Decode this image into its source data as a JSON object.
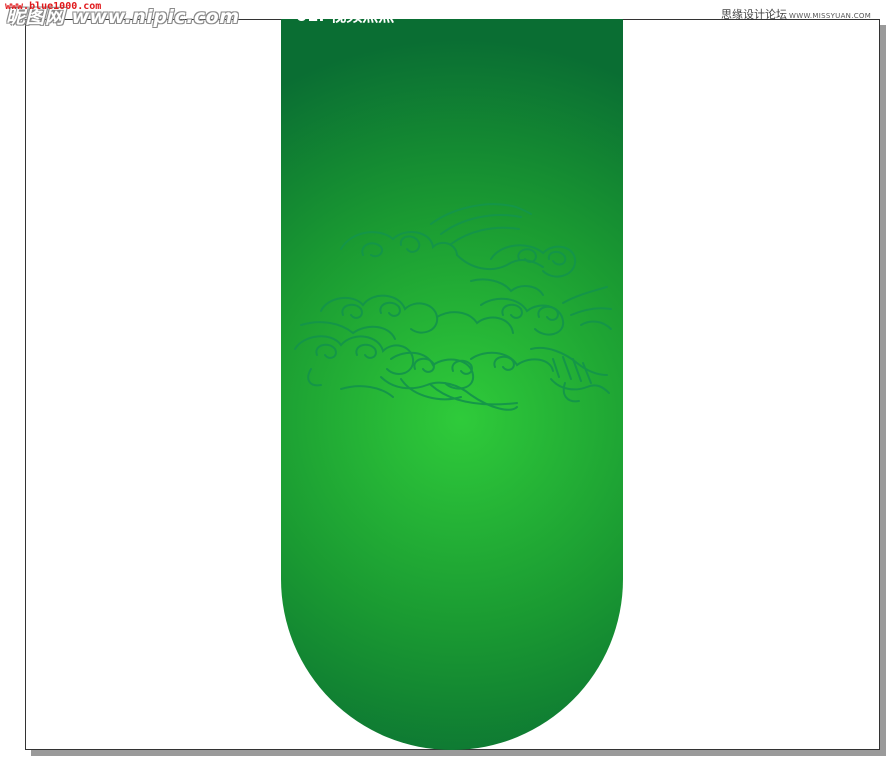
{
  "canvas": {
    "page_color": "#ffffff",
    "shadow_color": "#9a9a9a",
    "border_color": "#333333"
  },
  "shape": {
    "name": "rounded-bottom-green-banner",
    "gradient_center_color": "#2fcb3a",
    "gradient_mid_color": "#1a9a32",
    "gradient_edge_color": "#0a6e33",
    "cloud_stroke_color": "#14954a"
  },
  "step_label": "01: 视频照照",
  "watermarks": {
    "blue1000": "www.blue1000.com",
    "nipic": "昵图网 www.nipic.com",
    "missyuan_cn": "思缘设计论坛",
    "missyuan_site": "WWW.MISSYUAN.COM"
  },
  "colors": {
    "watermark_red": "#e0181b",
    "watermark_gray": "#8a8a8a"
  }
}
